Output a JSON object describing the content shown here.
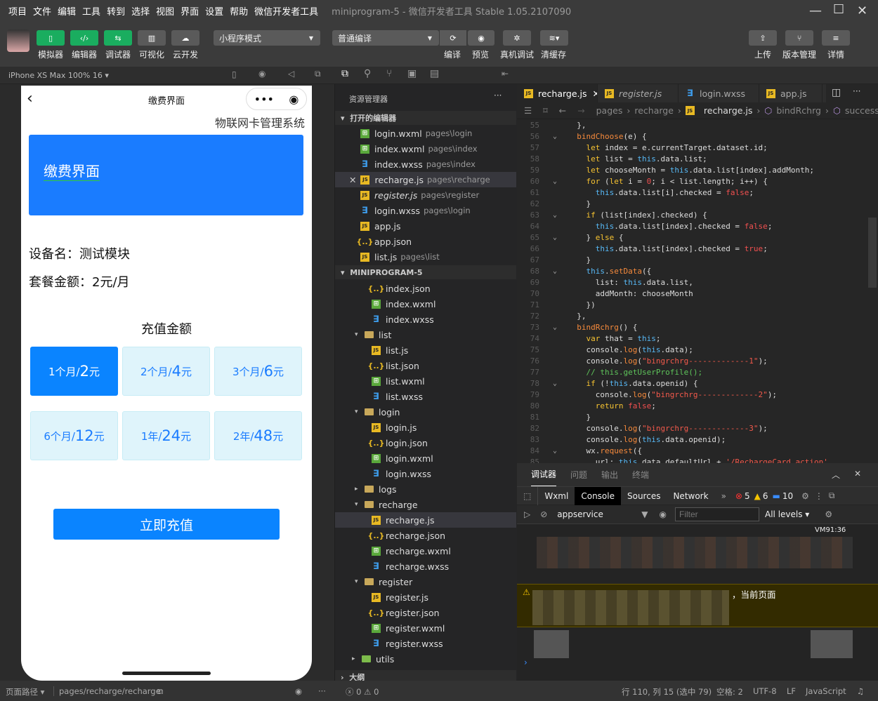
{
  "menu": [
    "项目",
    "文件",
    "编辑",
    "工具",
    "转到",
    "选择",
    "视图",
    "界面",
    "设置",
    "帮助",
    "微信开发者工具"
  ],
  "window_title": "miniprogram-5 - 微信开发者工具 Stable 1.05.2107090",
  "toolbar": {
    "left": [
      {
        "label": "模拟器",
        "icon": "phone-icon"
      },
      {
        "label": "编辑器",
        "icon": "code-icon"
      },
      {
        "label": "调试器",
        "icon": "debug-icon"
      },
      {
        "label": "可视化",
        "icon": "layout-icon"
      },
      {
        "label": "云开发",
        "icon": "cloud-icon"
      }
    ],
    "mode_select": "小程序模式",
    "compile_select": "普通编译",
    "right": [
      "编译",
      "预览",
      "真机调试",
      "清缓存"
    ],
    "far_right": [
      "上传",
      "版本管理",
      "详情"
    ]
  },
  "simulator": {
    "device": "iPhone XS Max 100% 16 ▾"
  },
  "phone": {
    "nav_title": "缴费界面",
    "app_name": "物联网卡管理系统",
    "banner": "缴费界面",
    "device_name": "设备名：测试模块",
    "package": "套餐金额：2元/月",
    "recharge_title": "充值金额",
    "options": [
      {
        "p": "1个月/",
        "n": "2",
        "u": "元",
        "checked": true
      },
      {
        "p": "2个月/",
        "n": "4",
        "u": "元",
        "checked": false
      },
      {
        "p": "3个月/",
        "n": "6",
        "u": "元",
        "checked": false
      },
      {
        "p": "6个月/",
        "n": "12",
        "u": "元",
        "checked": false
      },
      {
        "p": "1年/",
        "n": "24",
        "u": "元",
        "checked": false
      },
      {
        "p": "2年/",
        "n": "48",
        "u": "元",
        "checked": false
      }
    ],
    "button": "立即充值"
  },
  "explorer": {
    "title": "资源管理器",
    "open_header": "打开的编辑器",
    "project_header": "MINIPROGRAM-5",
    "outline": "大纲",
    "open": [
      {
        "name": "login.wxml",
        "path": "pages\\login",
        "type": "wxml"
      },
      {
        "name": "index.wxml",
        "path": "pages\\index",
        "type": "wxml"
      },
      {
        "name": "index.wxss",
        "path": "pages\\index",
        "type": "wxss"
      },
      {
        "name": "recharge.js",
        "path": "pages\\recharge",
        "type": "js",
        "active": true
      },
      {
        "name": "register.js",
        "path": "pages\\register",
        "type": "js"
      },
      {
        "name": "login.wxss",
        "path": "pages\\login",
        "type": "wxss"
      },
      {
        "name": "app.js",
        "path": "",
        "type": "js"
      },
      {
        "name": "app.json",
        "path": "",
        "type": "json"
      },
      {
        "name": "list.js",
        "path": "pages\\list",
        "type": "js"
      }
    ],
    "tree": [
      {
        "name": "index.json",
        "d": 2,
        "type": "json"
      },
      {
        "name": "index.wxml",
        "d": 2,
        "type": "wxml"
      },
      {
        "name": "index.wxss",
        "d": 2,
        "type": "wxss"
      },
      {
        "name": "list",
        "d": 1,
        "type": "folder",
        "open": true
      },
      {
        "name": "list.js",
        "d": 2,
        "type": "js"
      },
      {
        "name": "list.json",
        "d": 2,
        "type": "json"
      },
      {
        "name": "list.wxml",
        "d": 2,
        "type": "wxml"
      },
      {
        "name": "list.wxss",
        "d": 2,
        "type": "wxss"
      },
      {
        "name": "login",
        "d": 1,
        "type": "folder",
        "open": true
      },
      {
        "name": "login.js",
        "d": 2,
        "type": "js"
      },
      {
        "name": "login.json",
        "d": 2,
        "type": "json"
      },
      {
        "name": "login.wxml",
        "d": 2,
        "type": "wxml"
      },
      {
        "name": "login.wxss",
        "d": 2,
        "type": "wxss"
      },
      {
        "name": "logs",
        "d": 1,
        "type": "folder",
        "open": false
      },
      {
        "name": "recharge",
        "d": 1,
        "type": "folder",
        "open": true
      },
      {
        "name": "recharge.js",
        "d": 2,
        "type": "js",
        "active": true
      },
      {
        "name": "recharge.json",
        "d": 2,
        "type": "json"
      },
      {
        "name": "recharge.wxml",
        "d": 2,
        "type": "wxml"
      },
      {
        "name": "recharge.wxss",
        "d": 2,
        "type": "wxss"
      },
      {
        "name": "register",
        "d": 1,
        "type": "folder",
        "open": true
      },
      {
        "name": "register.js",
        "d": 2,
        "type": "js"
      },
      {
        "name": "register.json",
        "d": 2,
        "type": "json"
      },
      {
        "name": "register.wxml",
        "d": 2,
        "type": "wxml"
      },
      {
        "name": "register.wxss",
        "d": 2,
        "type": "wxss"
      },
      {
        "name": "utils",
        "d": 0,
        "type": "folder",
        "open": false,
        "green": true
      }
    ]
  },
  "editor": {
    "tabs": [
      {
        "name": "recharge.js",
        "type": "js",
        "active": true
      },
      {
        "name": "register.js",
        "type": "js"
      },
      {
        "name": "login.wxss",
        "type": "wxss"
      },
      {
        "name": "app.js",
        "type": "js"
      }
    ],
    "breadcrumb": [
      "pages",
      "recharge",
      "recharge.js",
      "bindRchrg",
      "success"
    ],
    "first_line": 55,
    "folds": [
      56,
      60,
      63,
      65,
      68,
      73,
      78,
      84,
      86
    ],
    "lines": [
      "  },",
      "  bindChoose(e) {",
      "    let index = e.currentTarget.dataset.id;",
      "    let list = this.data.list;",
      "    let chooseMonth = this.data.list[index].addMonth;",
      "    for (let i = 0; i < list.length; i++) {",
      "      this.data.list[i].checked = false;",
      "    }",
      "    if (list[index].checked) {",
      "      this.data.list[index].checked = false;",
      "    } else {",
      "      this.data.list[index].checked = true;",
      "    }",
      "    this.setData({",
      "      list: this.data.list,",
      "      addMonth: chooseMonth",
      "    })",
      "  },",
      "  bindRchrg() {",
      "    var that = this;",
      "    console.log(this.data);",
      "    console.log(\"bingrchrg-------------1\");",
      "    // this.getUserProfile();",
      "    if (!this.data.openid) {",
      "      console.log(\"bingrchrg-------------2\");",
      "      return false;",
      "    }",
      "    console.log(\"bingrchrg-------------3\");",
      "    console.log(this.data.openid);",
      "    wx.request({",
      "      url: this.data.defaultUrl + '/RechargeCard.action',",
      "      data: {"
    ]
  },
  "devtools": {
    "tabs": [
      "调试器",
      "问题",
      "输出",
      "终端"
    ],
    "panels": [
      "Wxml",
      "Console",
      "Sources",
      "Network"
    ],
    "errors": "5",
    "warnings": "6",
    "infos": "10",
    "context": "appservice",
    "filter_placeholder": "Filter",
    "levels": "All levels ▾",
    "warning_text": "，当前页面",
    "timestamp": "VM91:36"
  },
  "status": {
    "page_path_label": "页面路径 ▾",
    "page_path": "pages/recharge/recharge",
    "problems": "ⓧ 0 ⚠ 0",
    "position": "行 110, 列 15 (选中 79)",
    "spaces": "空格: 2",
    "encoding": "UTF-8",
    "eol": "LF",
    "language": "JavaScript"
  }
}
